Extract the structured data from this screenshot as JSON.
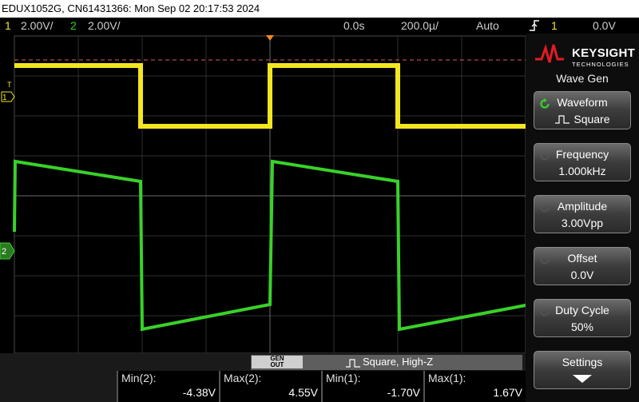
{
  "title_bar": "EDUX1052G, CN61431366: Mon Sep 02 20:17:53 2024",
  "status": {
    "ch1_num": "1",
    "ch1_scale": "2.00V/",
    "ch2_num": "2",
    "ch2_scale": "2.00V/",
    "time_offset": "0.0s",
    "time_scale": "200.0µ/",
    "trigger_mode": "Auto",
    "trigger_icon": "rising-edge-icon",
    "trigger_source": "1",
    "trigger_level": "0.0V"
  },
  "markers": {
    "trigger_T": "T",
    "ch1": "1",
    "ch2": "2"
  },
  "brand": {
    "name": "KEYSIGHT",
    "sub": "TECHNOLOGIES"
  },
  "panel": {
    "title": "Wave Gen",
    "softkeys": [
      {
        "label": "Waveform",
        "value": "Square",
        "knob": "entry-knob-icon",
        "active": true,
        "value_icon": "square-wave-icon"
      },
      {
        "label": "Frequency",
        "value": "1.000kHz",
        "knob": "entry-knob-icon",
        "active": false
      },
      {
        "label": "Amplitude",
        "value": "3.00Vpp",
        "knob": "entry-knob-icon",
        "active": false
      },
      {
        "label": "Offset",
        "value": "0.0V",
        "knob": "entry-knob-icon",
        "active": false
      },
      {
        "label": "Duty Cycle",
        "value": "50%",
        "knob": "entry-knob-icon",
        "active": false
      },
      {
        "label": "Settings",
        "value": "",
        "knob": "",
        "active": false,
        "value_icon": "down-arrow-icon"
      }
    ]
  },
  "gen_bar": {
    "badge_top": "GEN",
    "badge_bottom": "OUT",
    "text": "Square, High-Z"
  },
  "measurements": [
    {
      "label": "Min(2):",
      "value": "-4.38V"
    },
    {
      "label": "Max(2):",
      "value": "4.55V"
    },
    {
      "label": "Min(1):",
      "value": "-1.70V"
    },
    {
      "label": "Max(1):",
      "value": "1.67V"
    }
  ],
  "colors": {
    "ch1": "#f3e620",
    "ch2": "#39d12a",
    "trigger_line": "#e05a5a",
    "trigger_marker": "#f08a1a"
  }
}
